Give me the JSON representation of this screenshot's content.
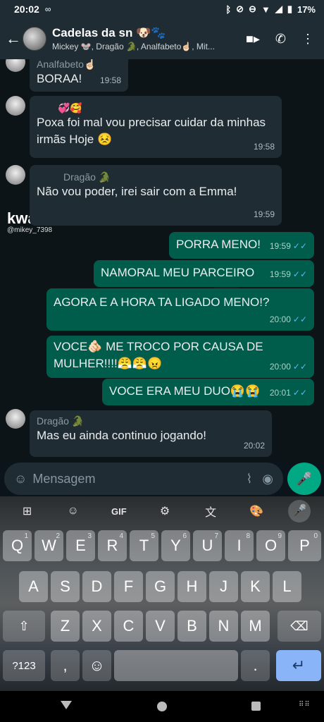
{
  "status_bar": {
    "time": "20:02",
    "extra": "∞",
    "battery": "17%"
  },
  "header": {
    "back_glyph": "←",
    "title": "Cadelas da sn 🐶🐾",
    "members": "Mickey 🐭, Dragão 🐊, Analfabeto☝🏻, Mit..."
  },
  "messages": {
    "m1": {
      "sender": "Analfabeto☝🏻",
      "text": "BORAA!",
      "time": "19:58"
    },
    "m2": {
      "sender": "💞🥰",
      "text": "Poxa foi mal vou precisar cuidar da minhas irmãs Hoje 😣",
      "time": "19:58"
    },
    "m3": {
      "sender": "Dragão 🐊",
      "text": "Não vou poder, irei sair com a Emma!",
      "time": "19:59"
    },
    "m4": {
      "text": "PORRA MENO!",
      "time": "19:59"
    },
    "m5": {
      "text": "NAMORAL MEU PARCEIRO",
      "time": "19:59"
    },
    "m6": {
      "text": "AGORA E A HORA TA LIGADO MENO!?",
      "time": "20:00"
    },
    "m7": {
      "text": "VOCE🫵🏻 ME TROCO POR CAUSA DE MULHER!!!!😤😤😠",
      "time": "20:00"
    },
    "m8": {
      "text": "VOCE ERA MEU DUO😭😭",
      "time": "20:01"
    },
    "m9": {
      "sender": "Dragão 🐊",
      "text": "Mas eu ainda continuo jogando!",
      "time": "20:02"
    },
    "ticks": "✓✓"
  },
  "watermark": {
    "brand": "kwai",
    "handle": "@mikey_7398"
  },
  "composer": {
    "placeholder": "Mensagem"
  },
  "keyboard": {
    "toolbar": [
      "⊞",
      "☺",
      "GIF",
      "⚙",
      "文",
      "🎨",
      "🎤"
    ],
    "row1": [
      "Q",
      "W",
      "E",
      "R",
      "T",
      "Y",
      "U",
      "I",
      "O",
      "P"
    ],
    "row1_hints": [
      "1",
      "2",
      "3",
      "4",
      "5",
      "6",
      "7",
      "8",
      "9",
      "0"
    ],
    "row2": [
      "A",
      "S",
      "D",
      "F",
      "G",
      "H",
      "J",
      "K",
      "L"
    ],
    "row3": [
      "Z",
      "X",
      "C",
      "V",
      "B",
      "N",
      "M"
    ],
    "shift": "⇧",
    "backspace": "⌫",
    "symbols": "?123",
    "comma": ",",
    "emoji": "☺",
    "period": ".",
    "enter": "↵"
  },
  "colors": {
    "header": "#1f2c34",
    "outgoing": "#005c4b",
    "incoming": "#1f2c34",
    "accent": "#00a884",
    "ticks": "#53bdeb"
  }
}
